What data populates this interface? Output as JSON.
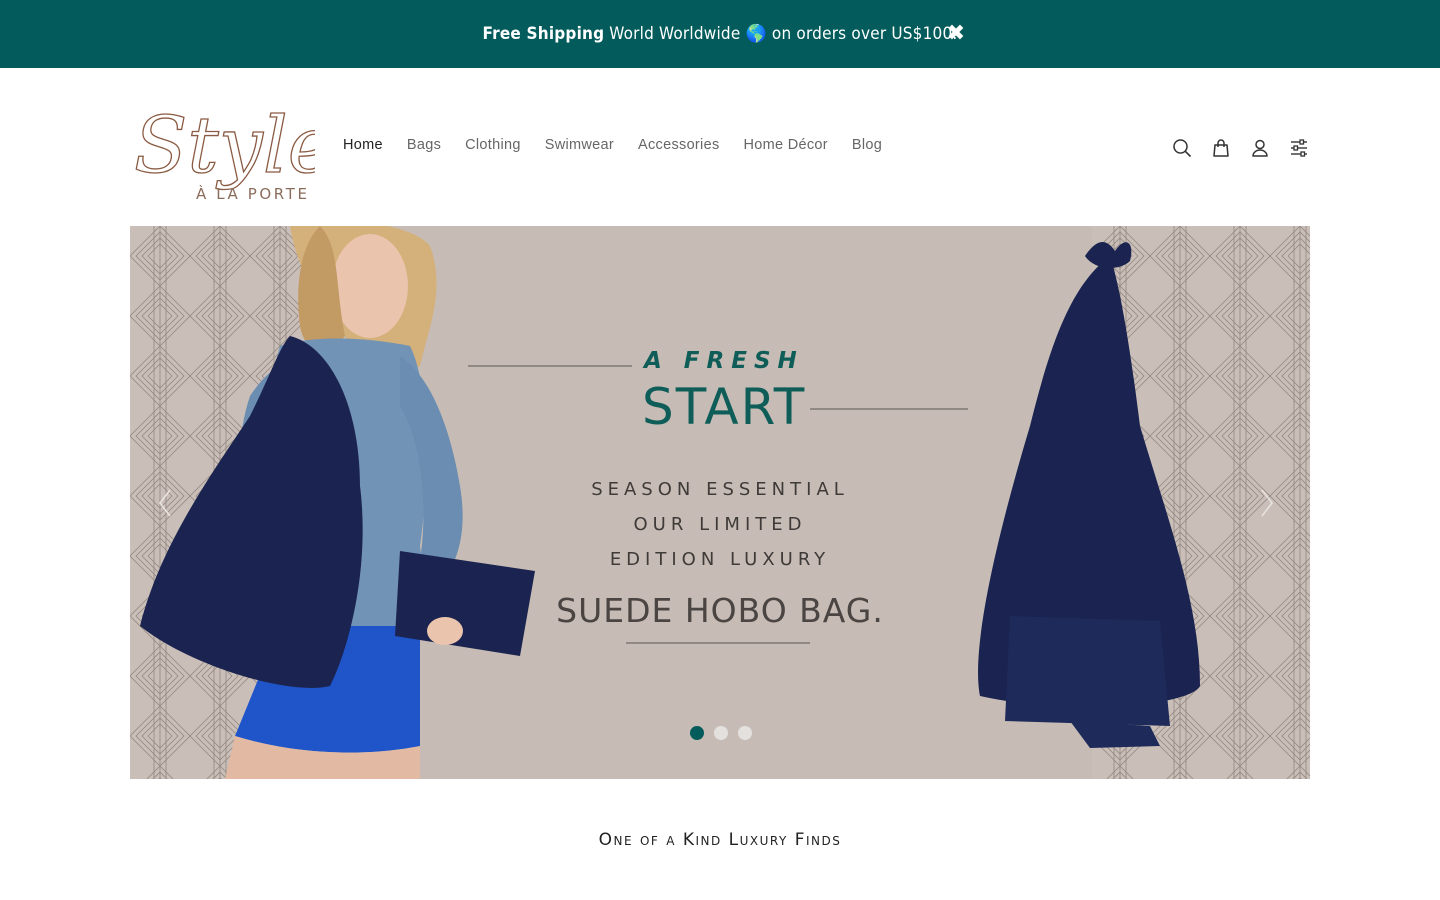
{
  "announcement": {
    "bold": "Free Shipping",
    "text": "World Worldwide 🌎 on orders over US$100.",
    "close": "✖"
  },
  "logo": {
    "script": "Style",
    "sub": "À LA PORTE"
  },
  "nav": [
    {
      "label": "Home"
    },
    {
      "label": "Bags"
    },
    {
      "label": "Clothing"
    },
    {
      "label": "Swimwear"
    },
    {
      "label": "Accessories"
    },
    {
      "label": "Home Décor"
    },
    {
      "label": "Blog"
    }
  ],
  "header_icons": [
    "search-icon",
    "bag-icon",
    "account-icon",
    "filter-icon"
  ],
  "hero": {
    "line1": "A FRESH",
    "line2": "START",
    "line3": "SEASON ESSENTIAL",
    "line4": "OUR LIMITED",
    "line5": "EDITION LUXURY",
    "line6": "SUEDE HOBO BAG.",
    "slide_index": 1,
    "slide_count": 3
  },
  "tagline": "One of a Kind Luxury Finds",
  "colors": {
    "brand": "#035c5b",
    "hero_bg": "#c7bcb5",
    "navy": "#1b2450",
    "denim": "#7193b6",
    "royal_blue": "#1f55c9"
  }
}
